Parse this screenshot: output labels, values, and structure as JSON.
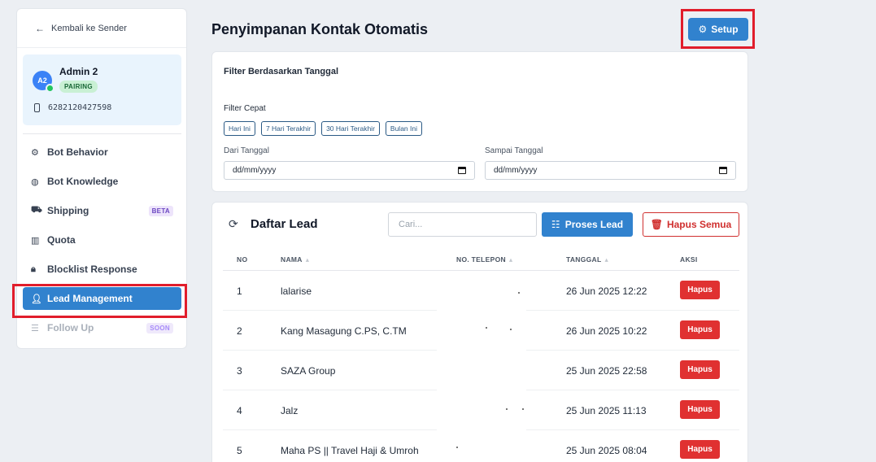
{
  "sidebar": {
    "back_label": "Kembali ke Sender",
    "account": {
      "initials": "A2",
      "name": "Admin 2",
      "status": "PAIRING",
      "phone": "6282120427598"
    },
    "items": [
      {
        "label": "Bot Behavior",
        "icon": "robot-icon"
      },
      {
        "label": "Bot Knowledge",
        "icon": "brain-icon"
      },
      {
        "label": "Shipping",
        "icon": "truck-icon",
        "tag": "BETA"
      },
      {
        "label": "Quota",
        "icon": "bar-chart-icon"
      },
      {
        "label": "Blocklist Response",
        "icon": "lock-icon"
      },
      {
        "label": "Lead Management",
        "icon": "user-check-icon",
        "active": true
      },
      {
        "label": "Follow Up",
        "icon": "sliders-icon",
        "tag": "SOON",
        "disabled": true
      }
    ]
  },
  "header": {
    "title": "Penyimpanan Kontak Otomatis",
    "setup_label": "Setup"
  },
  "filter": {
    "title": "Filter Berdasarkan Tanggal",
    "quick_label": "Filter Cepat",
    "chips": [
      "Hari Ini",
      "7 Hari Terakhir",
      "30 Hari Terakhir",
      "Bulan Ini"
    ],
    "from_label": "Dari Tanggal",
    "to_label": "Sampai Tanggal",
    "date_placeholder": "dd/mm/yyyy"
  },
  "leads": {
    "title": "Daftar Lead",
    "search_placeholder": "Cari...",
    "process_label": "Proses Lead",
    "delete_all_label": "Hapus Semua",
    "columns": {
      "no": "NO",
      "name": "NAMA",
      "phone": "NO. TELEPON",
      "date": "TANGGAL",
      "action": "AKSI"
    },
    "rows": [
      {
        "no": "1",
        "name": "lalarise",
        "date": "26 Jun 2025 12:22",
        "action": "Hapus"
      },
      {
        "no": "2",
        "name": "Kang Masagung C.PS, C.TM",
        "date": "26 Jun 2025 10:22",
        "action": "Hapus"
      },
      {
        "no": "3",
        "name": "SAZA Group",
        "date": "25 Jun 2025 22:58",
        "action": "Hapus"
      },
      {
        "no": "4",
        "name": "Jalz",
        "date": "25 Jun 2025 11:13",
        "action": "Hapus"
      },
      {
        "no": "5",
        "name": "Maha PS || Travel Haji & Umroh",
        "date": "25 Jun 2025 08:04",
        "action": "Hapus"
      }
    ]
  },
  "colors": {
    "primary": "#3182ce",
    "danger": "#e03131",
    "highlight": "#e11d2b"
  }
}
